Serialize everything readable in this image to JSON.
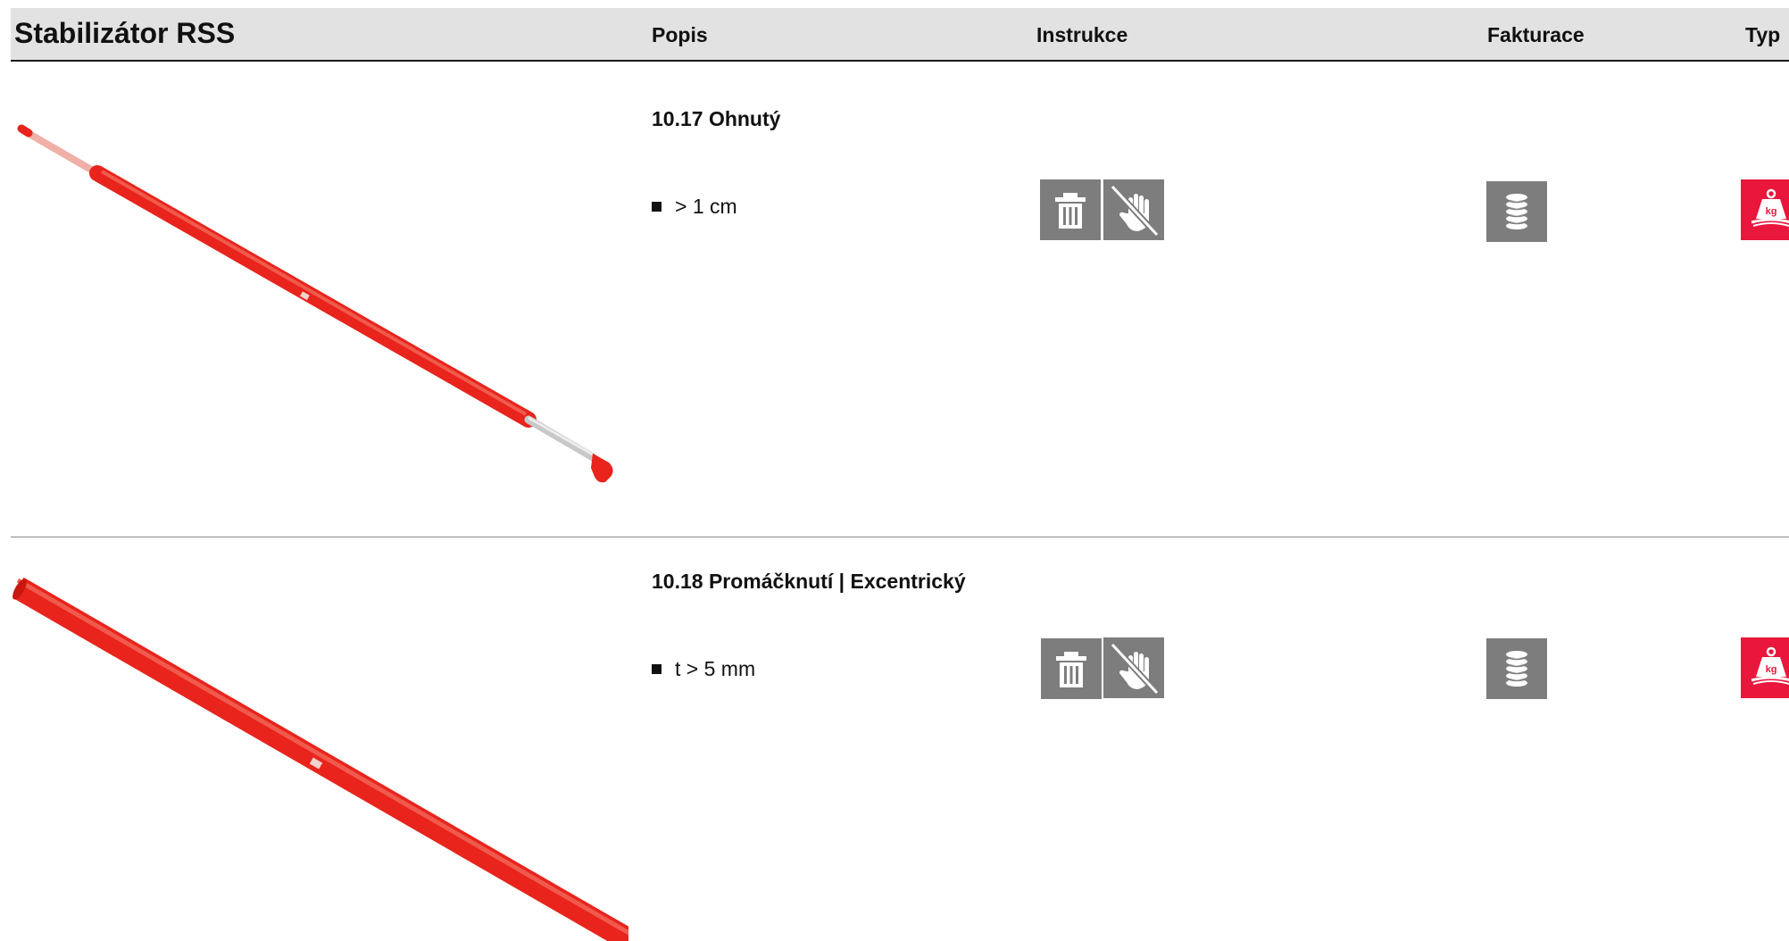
{
  "header": {
    "title": "Stabilizátor RSS",
    "col_popis": "Popis",
    "col_instrukce": "Instrukce",
    "col_fakturace": "Fakturace",
    "col_typ": "Typ"
  },
  "rows": [
    {
      "title": "10.17 Ohnutý",
      "bullet": "> 1 cm",
      "instrukce_icons": [
        "trash-icon",
        "no-hand-icon"
      ],
      "fakturace_icon": "coin-stack-icon",
      "typ_icon": "kg-weight-icon",
      "typ_badge": "kg"
    },
    {
      "title": "10.18 Promáčknutí | Excentrický",
      "bullet": "t > 5 mm",
      "instrukce_icons": [
        "trash-icon",
        "no-hand-icon"
      ],
      "fakturace_icon": "coin-stack-icon",
      "typ_icon": "kg-weight-icon",
      "typ_badge": "kg"
    }
  ],
  "colors": {
    "header_bg": "#e2e2e2",
    "icon_grey": "#7d7d7d",
    "icon_red": "#e8173b",
    "product_red": "#e8241c"
  }
}
